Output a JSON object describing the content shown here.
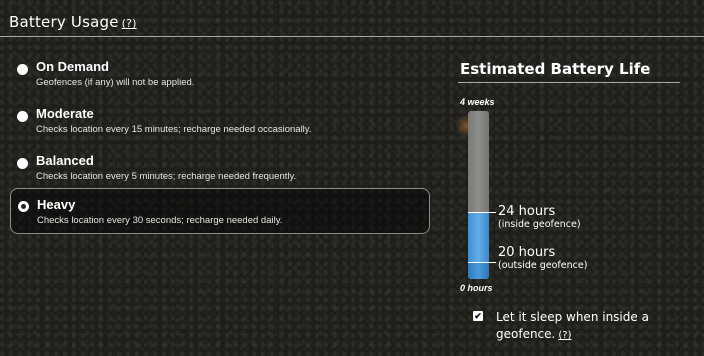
{
  "header": {
    "title": "Battery Usage",
    "help": "(?)"
  },
  "options": [
    {
      "title": "On Demand",
      "desc": "Geofences (if any) will not be applied.",
      "selected": false
    },
    {
      "title": "Moderate",
      "desc": "Checks location every 15 minutes; recharge needed occasionally.",
      "selected": false
    },
    {
      "title": "Balanced",
      "desc": "Checks location every 5 minutes; recharge needed frequently.",
      "selected": false
    },
    {
      "title": "Heavy",
      "desc": "Checks location every 30 seconds; recharge needed daily.",
      "selected": true
    }
  ],
  "estimate": {
    "title": "Estimated Battery Life",
    "top_label": "4 weeks",
    "bottom_label": "0 hours",
    "inside_fraction": 0.4,
    "outside_fraction": 0.1,
    "inside_value": "24 hours",
    "inside_sub": "(inside geofence)",
    "outside_value": "20 hours",
    "outside_sub": "(outside geofence)"
  },
  "sleep": {
    "checked": true,
    "label": "Let it sleep when inside a geofence.",
    "help": "(?)"
  },
  "colors": {
    "battery_fill": "#4f9ee0",
    "battery_empty": "#858581",
    "panel_border": "#8d8c87"
  }
}
